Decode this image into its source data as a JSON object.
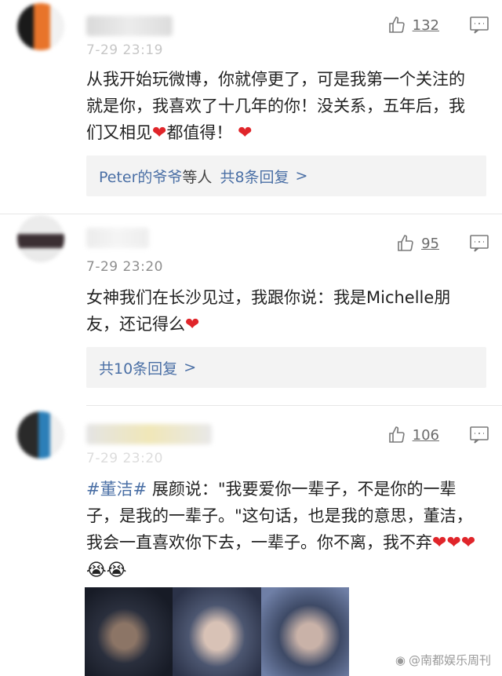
{
  "comments": [
    {
      "time": "7-29 23:19",
      "likes": "132",
      "text_parts": [
        "从我开始玩微博，你就停更了，可是我第一个关注的就是你，我喜欢了十几年的你！没关系，五年后，我们又相见",
        "都值得！"
      ],
      "reply_box": {
        "names": "Peter的爷爷",
        "connector": "等人",
        "total": "共8条回复",
        "arrow": ">"
      }
    },
    {
      "time": "7-29 23:20",
      "likes": "95",
      "text_parts": [
        "女神我们在长沙见过，我跟你说：我是Michelle朋友，还记得么"
      ],
      "reply_box": {
        "total": "共10条回复",
        "arrow": ">"
      }
    },
    {
      "time": "7-29 23:20",
      "likes": "106",
      "topic": "#董洁#",
      "text_parts": [
        " 展颜说：\"我要爱你一辈子，不是你的一辈子，是我的一辈子。\"这句话，也是我的意思，董洁，我会一直喜欢你下去，一辈子。你不离，我不弃"
      ]
    }
  ],
  "icons": {
    "heart": "❤",
    "cry": "😭",
    "like": "thumbs-up-icon",
    "reply": "comment-icon"
  },
  "watermark": "@南都娱乐周刊",
  "colors": {
    "link": "#4a6fa5",
    "heart": "#e0252a",
    "muted": "#8e8e8e"
  }
}
